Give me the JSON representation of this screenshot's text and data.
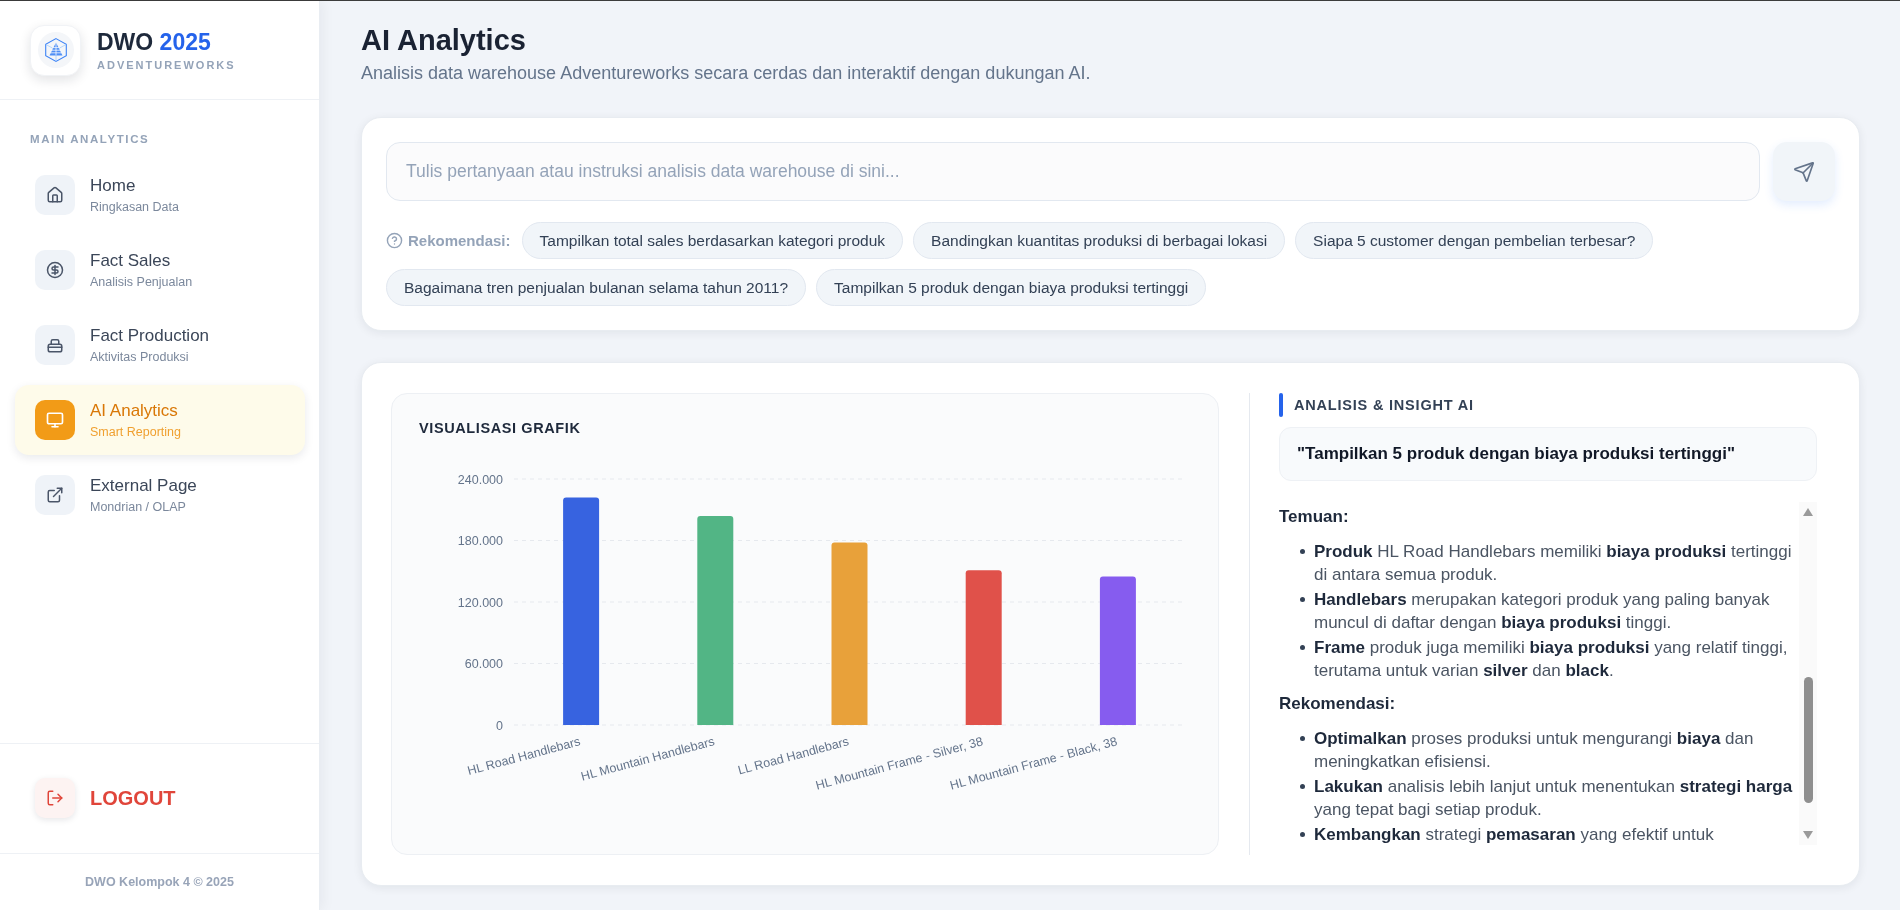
{
  "sidebar": {
    "brand": {
      "name": "DWO",
      "year": "2025",
      "subtitle": "ADVENTUREWORKS"
    },
    "section_label": "MAIN ANALYTICS",
    "items": [
      {
        "title": "Home",
        "subtitle": "Ringkasan Data",
        "selected": false
      },
      {
        "title": "Fact Sales",
        "subtitle": "Analisis Penjualan",
        "selected": false
      },
      {
        "title": "Fact Production",
        "subtitle": "Aktivitas Produksi",
        "selected": false
      },
      {
        "title": "AI Analytics",
        "subtitle": "Smart Reporting",
        "selected": true
      },
      {
        "title": "External Page",
        "subtitle": "Mondrian / OLAP",
        "selected": false
      }
    ],
    "logout": "LOGOUT",
    "footer": "DWO Kelompok 4 © 2025"
  },
  "header": {
    "title": "AI Analytics",
    "subtitle": "Analisis data warehouse Adventureworks secara cerdas dan interaktif dengan dukungan AI."
  },
  "query": {
    "placeholder": "Tulis pertanyaan atau instruksi analisis data warehouse di sini...",
    "recommendation_label": "Rekomendasi:",
    "suggestions": [
      "Tampilkan total sales berdasarkan kategori produk",
      "Bandingkan kuantitas produksi di berbagai lokasi",
      "Siapa 5 customer dengan pembelian terbesar?",
      "Bagaimana tren penjualan bulanan selama tahun 2011?",
      "Tampilkan 5 produk dengan biaya produksi tertinggi"
    ]
  },
  "chart": {
    "chart_data": {
      "type": "bar",
      "title": "VISUALISASI GRAFIK",
      "categories": [
        "HL Road Handlebars",
        "HL Mountain Handlebars",
        "LL Road Handlebars",
        "HL Mountain Frame - Silver, 38",
        "HL Mountain Frame - Black, 38"
      ],
      "values": [
        222000,
        204000,
        178000,
        151000,
        145000
      ],
      "colors": [
        "#3763e0",
        "#52b585",
        "#e8a13a",
        "#e0514a",
        "#865cef"
      ],
      "ylim": [
        0,
        240000
      ],
      "yticks": [
        {
          "value": 0,
          "label": "0"
        },
        {
          "value": 60000,
          "label": "60.000"
        },
        {
          "value": 120000,
          "label": "120.000"
        },
        {
          "value": 180000,
          "label": "180.000"
        },
        {
          "value": 240000,
          "label": "240.000"
        }
      ],
      "grid": true
    }
  },
  "insight": {
    "title": "ANALISIS & INSIGHT AI",
    "query": "\"Tampilkan 5 produk dengan biaya produksi tertinggi\"",
    "sections": [
      {
        "heading": "Temuan:",
        "points": [
          "**Produk** HL Road Handlebars memiliki **biaya produksi** tertinggi di antara semua produk.",
          "**Handlebars** merupakan kategori produk yang paling banyak muncul di daftar dengan **biaya produksi** tinggi.",
          "**Frame** produk juga memiliki **biaya produksi** yang relatif tinggi, terutama untuk varian **silver** dan **black**."
        ]
      },
      {
        "heading": "Rekomendasi:",
        "points": [
          "**Optimalkan** proses produksi untuk mengurangi **biaya** dan meningkatkan efisiensi.",
          "**Lakukan** analisis lebih lanjut untuk menentukan **strategi harga** yang tepat bagi setiap produk.",
          "**Kembangkan** strategi **pemasaran** yang efektif untuk"
        ]
      }
    ]
  }
}
